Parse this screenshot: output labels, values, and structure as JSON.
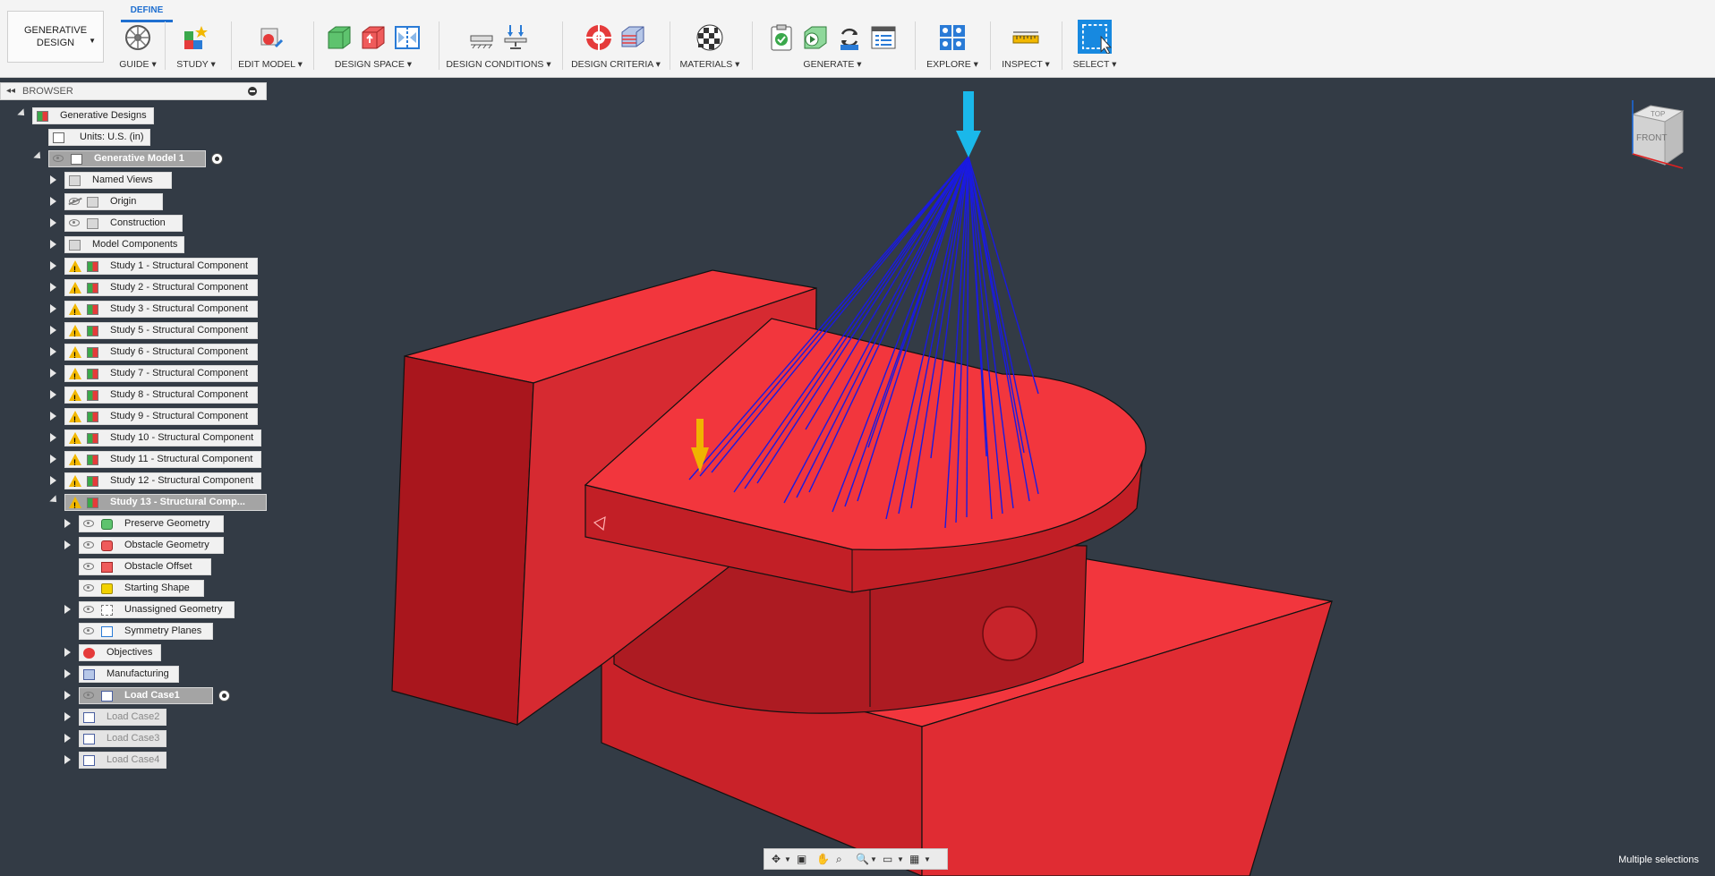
{
  "workspace": {
    "label_line1": "GENERATIVE",
    "label_line2": "DESIGN"
  },
  "tabs": {
    "active": "DEFINE"
  },
  "toolbar": {
    "guide": "GUIDE",
    "study": "STUDY",
    "edit_model": "EDIT MODEL",
    "design_space": "DESIGN SPACE",
    "design_conditions": "DESIGN CONDITIONS",
    "design_criteria": "DESIGN CRITERIA",
    "materials": "MATERIALS",
    "generate": "GENERATE",
    "explore": "EXPLORE",
    "inspect": "INSPECT",
    "select": "SELECT"
  },
  "browser": {
    "title": "BROWSER",
    "root": "Generative Designs",
    "units": "Units: U.S. (in)",
    "model": "Generative Model 1",
    "named_views": "Named Views",
    "origin": "Origin",
    "construction": "Construction",
    "model_components": "Model Components",
    "studies": [
      "Study 1 - Structural Component",
      "Study 2 - Structural Component",
      "Study 3 - Structural Component",
      "Study 5 - Structural Component",
      "Study 6 - Structural Component",
      "Study 7 - Structural Component",
      "Study 8 - Structural Component",
      "Study 9 - Structural Component",
      "Study 10 - Structural Component",
      "Study 11 - Structural Component",
      "Study 12 - Structural Component"
    ],
    "active_study": "Study 13 - Structural Comp...",
    "preserve": "Preserve Geometry",
    "obstacle": "Obstacle Geometry",
    "obstacle_offset": "Obstacle Offset",
    "starting_shape": "Starting Shape",
    "unassigned": "Unassigned Geometry",
    "symmetry": "Symmetry Planes",
    "objectives": "Objectives",
    "manufacturing": "Manufacturing",
    "load_case1": "Load Case1",
    "load_case2": "Load Case2",
    "load_case3": "Load Case3",
    "load_case4": "Load Case4"
  },
  "viewcube": {
    "top": "TOP",
    "front": "FRONT"
  },
  "status": {
    "text": "Multiple selections"
  },
  "colors": {
    "model_red": "#f2363d",
    "force_blue": "#1a1ae0",
    "load_cyan": "#1ab8ea",
    "gravity_yellow": "#f0b400",
    "accent": "#1f6fd0"
  }
}
